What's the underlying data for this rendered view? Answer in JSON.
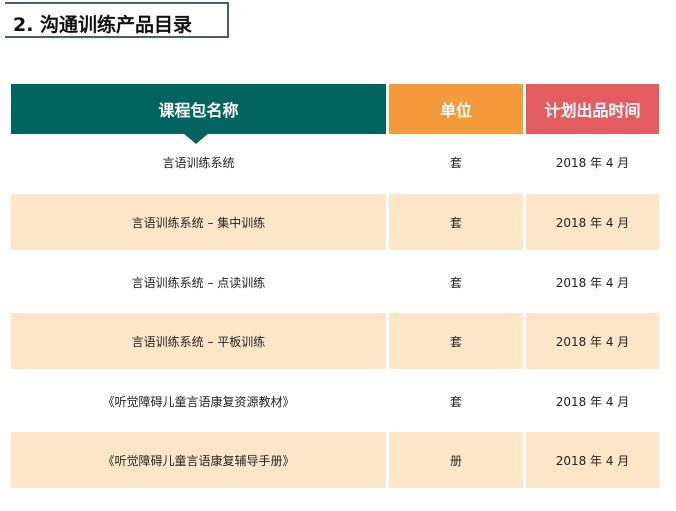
{
  "title": "2. 沟通训练产品目录",
  "table": {
    "headers": [
      "课程包名称",
      "单位",
      "计划出品时间"
    ],
    "rows": [
      {
        "name": "言语训练系统",
        "unit": "套",
        "date": "2018 年 4 月"
      },
      {
        "name": "言语训练系统 – 集中训练",
        "unit": "套",
        "date": "2018 年 4 月"
      },
      {
        "name": "言语训练系统 – 点读训练",
        "unit": "套",
        "date": "2018 年 4 月"
      },
      {
        "name": "言语训练系统 – 平板训练",
        "unit": "套",
        "date": "2018 年 4 月"
      },
      {
        "name": "《听觉障碍儿童言语康复资源教材》",
        "unit": "套",
        "date": "2018 年 4 月"
      },
      {
        "name": "《听觉障碍儿童言语康复辅导手册》",
        "unit": "册",
        "date": "2018 年 4 月"
      }
    ]
  },
  "colors": {
    "header_name": "#02645f",
    "header_unit": "#f49a3a",
    "header_date": "#e45c5f",
    "row_shade": "#fde6c8",
    "title_border": "#4a5f6e"
  }
}
